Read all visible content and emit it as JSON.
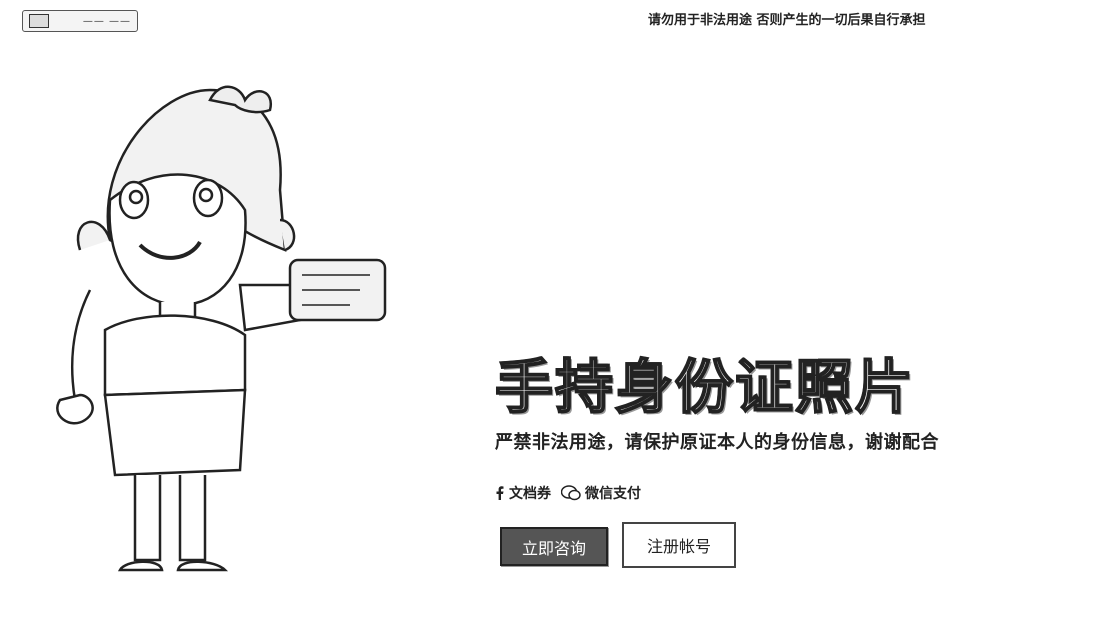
{
  "header": {
    "logo_text": "—— ——",
    "notice": "请勿用于非法用途 否则产生的一切后果自行承担"
  },
  "hero": {
    "title": "手持身份证照片",
    "subtitle": "严禁非法用途，请保护原证本人的身份信息，谢谢配合",
    "share": {
      "facebook_label": "文档券",
      "wechat_label": "微信支付"
    },
    "primary_button": "立即咨询",
    "secondary_button": "注册帐号"
  },
  "icons": {
    "facebook": "facebook-icon",
    "wechat": "wechat-icon",
    "illustration": "woman-holding-card-illustration"
  },
  "colors": {
    "primary_button": "#555555",
    "background": "#ffffff",
    "text": "#222222"
  }
}
